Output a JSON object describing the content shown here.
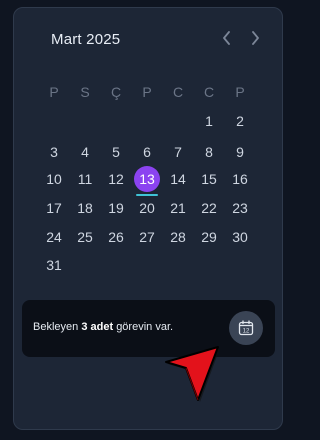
{
  "calendar": {
    "month_title": "Mart 2025",
    "weekdays": [
      "P",
      "S",
      "Ç",
      "P",
      "C",
      "C",
      "P"
    ],
    "weeks": [
      [
        "",
        "",
        "",
        "",
        "",
        "1",
        "2"
      ],
      [
        "3",
        "4",
        "5",
        "6",
        "7",
        "8",
        "9"
      ],
      [
        "10",
        "11",
        "12",
        "13",
        "14",
        "15",
        "16"
      ],
      [
        "17",
        "18",
        "19",
        "20",
        "21",
        "22",
        "23"
      ],
      [
        "24",
        "25",
        "26",
        "27",
        "28",
        "29",
        "30"
      ],
      [
        "31",
        "",
        "",
        "",
        "",
        "",
        ""
      ]
    ],
    "today": "13",
    "nav_prev_icon": "chevron-left-icon",
    "nav_next_icon": "chevron-right-icon"
  },
  "tasks": {
    "prefix": "Bekleyen",
    "count_text": "3 adet",
    "suffix": "görevin var.",
    "button_icon": "calendar-icon",
    "button_icon_number": "12"
  },
  "colors": {
    "today_circle": "#8b43f0",
    "today_underline": "#3fc3d6",
    "pointer": "#e3121b"
  }
}
